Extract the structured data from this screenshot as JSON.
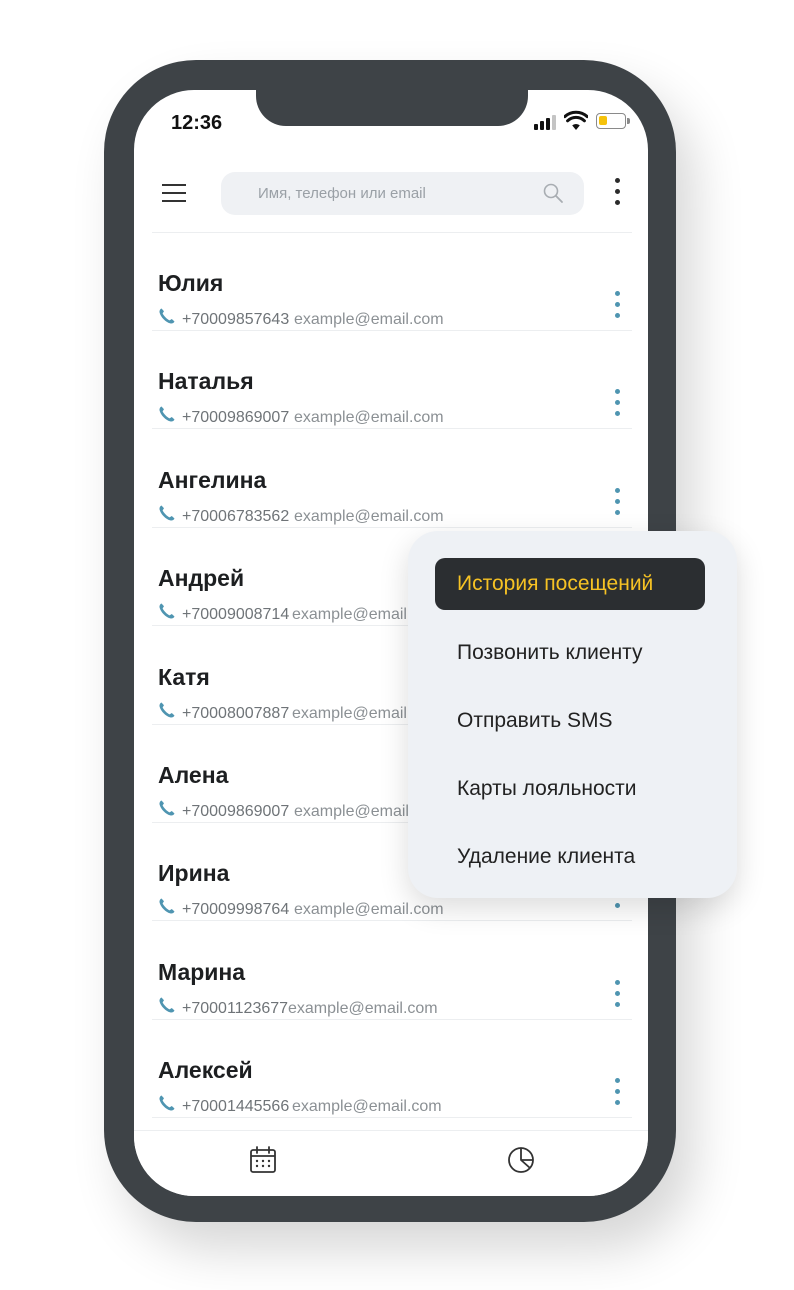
{
  "status_bar": {
    "time": "12:36"
  },
  "search": {
    "placeholder": "Имя, телефон или email"
  },
  "contacts": [
    {
      "name": "Юлия",
      "phone": "+70009857643",
      "email": "example@email.com"
    },
    {
      "name": "Наталья",
      "phone": "+70009869007",
      "email": "example@email.com"
    },
    {
      "name": "Ангелина",
      "phone": "+70006783562",
      "email": "example@email.com"
    },
    {
      "name": "Андрей",
      "phone": "+70009008714",
      "email": "example@email.com"
    },
    {
      "name": "Катя",
      "phone": "+70008007887",
      "email": "example@email.com"
    },
    {
      "name": "Алена",
      "phone": "+70009869007",
      "email": "example@email.com"
    },
    {
      "name": "Ирина",
      "phone": "+70009998764",
      "email": "example@email.com"
    },
    {
      "name": "Марина",
      "phone": "+70001123677",
      "email": "example@email.com"
    },
    {
      "name": "Алексей",
      "phone": "+70001445566",
      "email": "example@email.com"
    }
  ],
  "context_menu": {
    "items": [
      {
        "label": "История посещений",
        "active": true
      },
      {
        "label": "Позвонить клиенту",
        "active": false
      },
      {
        "label": "Отправить SMS",
        "active": false
      },
      {
        "label": "Карты лояльности",
        "active": false
      },
      {
        "label": "Удаление клиента",
        "active": false
      }
    ]
  },
  "bottom_nav": {
    "items": [
      "calendar-icon",
      "stats-icon"
    ]
  },
  "colors": {
    "phone_frame": "#3e4347",
    "menu_bg": "#eef1f5",
    "menu_active_bg": "#2b2e31",
    "menu_active_text": "#f6c224",
    "accent_blue": "#4f95b1",
    "battery": "#f5c20b"
  }
}
